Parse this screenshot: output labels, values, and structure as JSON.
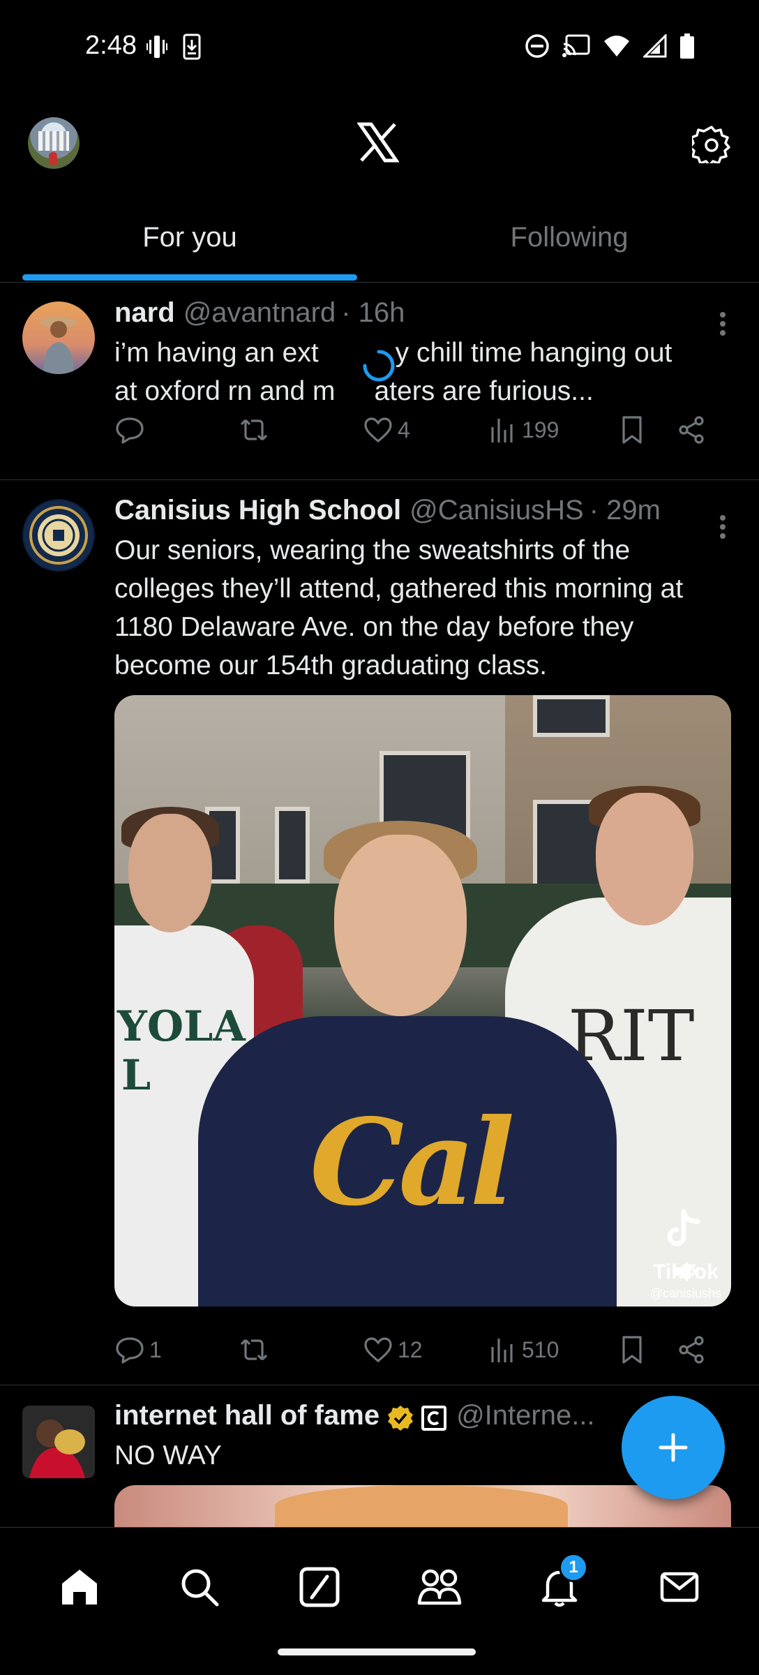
{
  "status_bar": {
    "time": "2:48"
  },
  "header": {
    "logo": "x-logo",
    "settings_icon": "gear-icon"
  },
  "tabs": [
    {
      "label": "For you",
      "active": true
    },
    {
      "label": "Following",
      "active": false
    }
  ],
  "tweets": [
    {
      "name": "nard",
      "handle": "@avantnard",
      "time": "· 16h",
      "text_1": "i’m having an ext",
      "text_2": "y chill time hanging out",
      "text_3": "at oxford rn and m",
      "text_4": "aters are furious...",
      "replies": "",
      "retweets": "",
      "likes": "4",
      "views": "199"
    },
    {
      "name": "Canisius High School",
      "handle": "@CanisiusHS",
      "time": "· 29m",
      "text": "Our seniors, wearing the sweatshirts of the colleges they’ll attend, gathered this morning at 1180 Delaware Ave. on the day before they become our 154th graduating class.",
      "replies": "1",
      "retweets": "",
      "likes": "12",
      "views": "510",
      "media": {
        "cal": "Cal",
        "rit": "RIT",
        "yola": "YOLA",
        "yola_letter": "L",
        "tiktok": "TikTok",
        "tiktok_user": "@canisiushs"
      }
    },
    {
      "name": "internet hall of fame",
      "handle": "@Interne...",
      "text": "NO WAY",
      "verified": true
    }
  ],
  "bottom_nav": [
    {
      "name": "home-icon"
    },
    {
      "name": "search-icon"
    },
    {
      "name": "grok-icon"
    },
    {
      "name": "communities-icon"
    },
    {
      "name": "notifications-icon",
      "badge": "1"
    },
    {
      "name": "messages-icon"
    }
  ],
  "colors": {
    "accent": "#1d9bf0",
    "background": "#000000",
    "secondary_text": "#71767b",
    "primary_text": "#e7e9ea"
  }
}
